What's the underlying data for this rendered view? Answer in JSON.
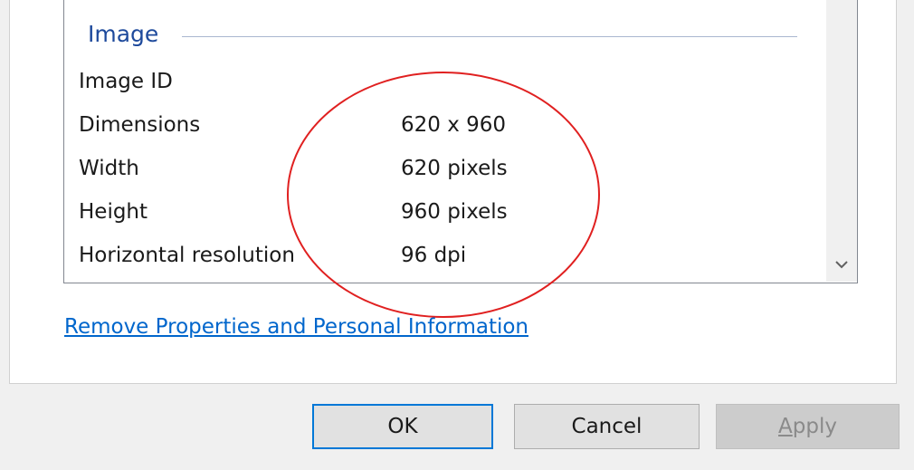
{
  "section": {
    "title": "Image"
  },
  "properties": [
    {
      "name": "Image ID",
      "value": ""
    },
    {
      "name": "Dimensions",
      "value": "620 x 960"
    },
    {
      "name": "Width",
      "value": "620 pixels"
    },
    {
      "name": "Height",
      "value": "960 pixels"
    },
    {
      "name": "Horizontal resolution",
      "value": "96 dpi"
    }
  ],
  "link": {
    "remove_label": "Remove Properties and Personal Information"
  },
  "buttons": {
    "ok_label": "OK",
    "cancel_label": "Cancel",
    "apply_accel": "A",
    "apply_rest": "pply"
  },
  "icons": {
    "scroll_down": "chevron-down-icon"
  },
  "colors": {
    "link": "#0066cc",
    "section_title": "#1e4a9c",
    "annotation_circle": "#e02020",
    "ok_border": "#0078d7"
  }
}
